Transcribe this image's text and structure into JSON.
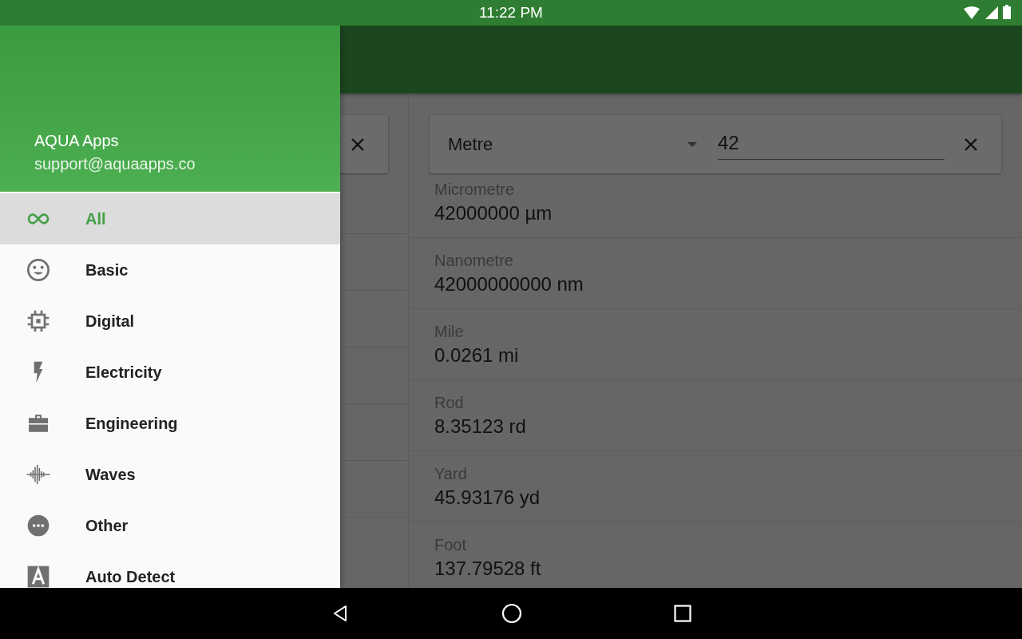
{
  "status_bar": {
    "time": "11:22 PM"
  },
  "drawer": {
    "account_name": "AQUA Apps",
    "account_email": "support@aquaapps.co",
    "items": [
      {
        "label": "All",
        "kind": "infinity",
        "selected": true
      },
      {
        "label": "Basic",
        "kind": "smiley",
        "selected": false
      },
      {
        "label": "Digital",
        "kind": "chip",
        "selected": false
      },
      {
        "label": "Electricity",
        "kind": "bolt",
        "selected": false
      },
      {
        "label": "Engineering",
        "kind": "briefcase",
        "selected": false
      },
      {
        "label": "Waves",
        "kind": "waves",
        "selected": false
      },
      {
        "label": "Other",
        "kind": "more",
        "selected": false
      },
      {
        "label": "Auto Detect",
        "kind": "auto",
        "selected": false
      }
    ]
  },
  "converter": {
    "unit": "Metre",
    "value": "42",
    "results": [
      {
        "name": "Micrometre",
        "value": "42000000 µm"
      },
      {
        "name": "Nanometre",
        "value": "42000000000 nm"
      },
      {
        "name": "Mile",
        "value": "0.0261 mi"
      },
      {
        "name": "Rod",
        "value": "8.35123 rd"
      },
      {
        "name": "Yard",
        "value": "45.93176 yd"
      },
      {
        "name": "Foot",
        "value": "137.79528 ft"
      }
    ]
  }
}
